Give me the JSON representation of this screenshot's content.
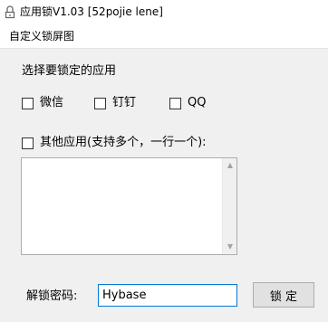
{
  "window": {
    "title": "应用锁V1.03 [52pojie lene]",
    "icon": "lock-app-icon"
  },
  "menubar": {
    "items": [
      "自定义锁屏图"
    ]
  },
  "main": {
    "select_label": "选择要锁定的应用",
    "apps": [
      {
        "label": "微信",
        "checked": false
      },
      {
        "label": "钉钉",
        "checked": false
      },
      {
        "label": "QQ",
        "checked": false
      }
    ],
    "other_apps": {
      "label": "其他应用(支持多个，一行一个):",
      "checked": false,
      "value": ""
    },
    "password": {
      "label": "解锁密码:",
      "value": "Hybase"
    },
    "lock_button_label": "锁 定"
  },
  "colors": {
    "client_bg": "#f0f0f0",
    "focus_border": "#0078d7",
    "button_bg": "#e1e1e1"
  }
}
